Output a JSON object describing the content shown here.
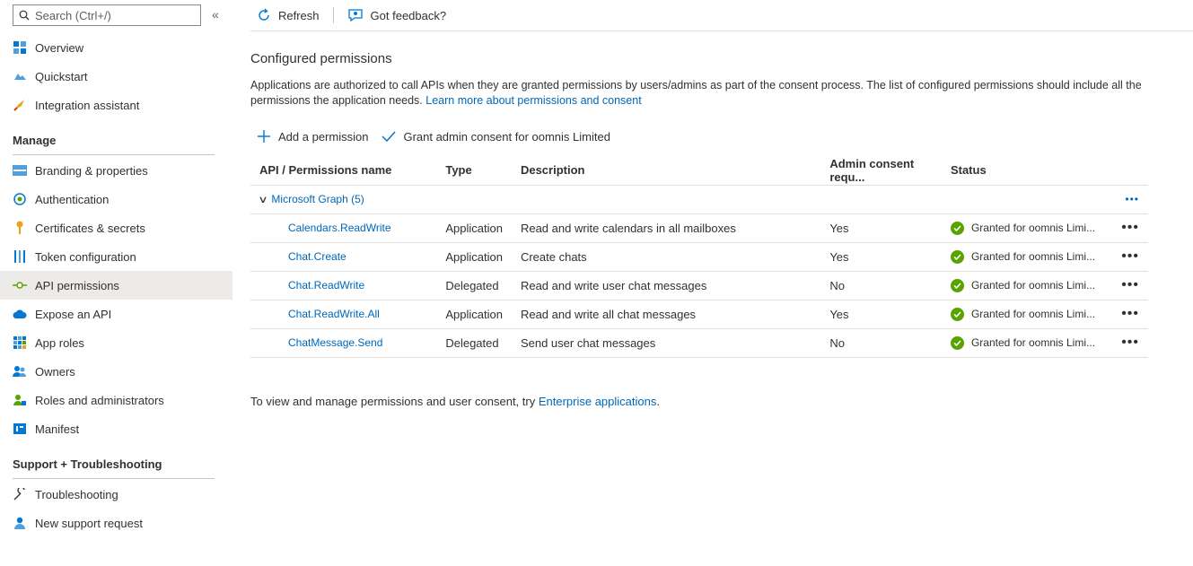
{
  "sidebar": {
    "search_placeholder": "Search (Ctrl+/)",
    "collapse_glyph": "«",
    "items_top": [
      {
        "label": "Overview",
        "icon": "overview-icon"
      },
      {
        "label": "Quickstart",
        "icon": "quickstart-icon"
      },
      {
        "label": "Integration assistant",
        "icon": "rocket-icon"
      }
    ],
    "manage_heading": "Manage",
    "items_manage": [
      {
        "label": "Branding & properties",
        "icon": "branding-icon"
      },
      {
        "label": "Authentication",
        "icon": "authentication-icon"
      },
      {
        "label": "Certificates & secrets",
        "icon": "key-icon"
      },
      {
        "label": "Token configuration",
        "icon": "token-icon"
      },
      {
        "label": "API permissions",
        "icon": "api-permissions-icon",
        "active": true
      },
      {
        "label": "Expose an API",
        "icon": "cloud-icon"
      },
      {
        "label": "App roles",
        "icon": "app-roles-icon"
      },
      {
        "label": "Owners",
        "icon": "owners-icon"
      },
      {
        "label": "Roles and administrators",
        "icon": "roles-icon"
      },
      {
        "label": "Manifest",
        "icon": "manifest-icon"
      }
    ],
    "support_heading": "Support + Troubleshooting",
    "items_support": [
      {
        "label": "Troubleshooting",
        "icon": "wrench-icon"
      },
      {
        "label": "New support request",
        "icon": "support-icon"
      }
    ]
  },
  "toolbar": {
    "refresh_label": "Refresh",
    "feedback_label": "Got feedback?"
  },
  "main": {
    "title": "Configured permissions",
    "description": "Applications are authorized to call APIs when they are granted permissions by users/admins as part of the consent process. The list of configured permissions should include all the permissions the application needs.",
    "learn_more": "Learn more about permissions and consent",
    "add_permission": "Add a permission",
    "grant_consent": "Grant admin consent for oomnis Limited",
    "columns": [
      "API / Permissions name",
      "Type",
      "Description",
      "Admin consent requ...",
      "Status"
    ],
    "group_label": "Microsoft Graph (5)",
    "rows": [
      {
        "name": "Calendars.ReadWrite",
        "type": "Application",
        "description": "Read and write calendars in all mailboxes",
        "admin": "Yes",
        "status": "Granted for oomnis Limi..."
      },
      {
        "name": "Chat.Create",
        "type": "Application",
        "description": "Create chats",
        "admin": "Yes",
        "status": "Granted for oomnis Limi..."
      },
      {
        "name": "Chat.ReadWrite",
        "type": "Delegated",
        "description": "Read and write user chat messages",
        "admin": "No",
        "status": "Granted for oomnis Limi..."
      },
      {
        "name": "Chat.ReadWrite.All",
        "type": "Application",
        "description": "Read and write all chat messages",
        "admin": "Yes",
        "status": "Granted for oomnis Limi..."
      },
      {
        "name": "ChatMessage.Send",
        "type": "Delegated",
        "description": "Send user chat messages",
        "admin": "No",
        "status": "Granted for oomnis Limi..."
      }
    ],
    "more_glyph": "•••",
    "footer_text": "To view and manage permissions and user consent, try ",
    "footer_link": "Enterprise applications",
    "footer_end": "."
  },
  "colors": {
    "accent": "#0067b8",
    "success": "#57a300",
    "active_bg": "#edebe9"
  }
}
